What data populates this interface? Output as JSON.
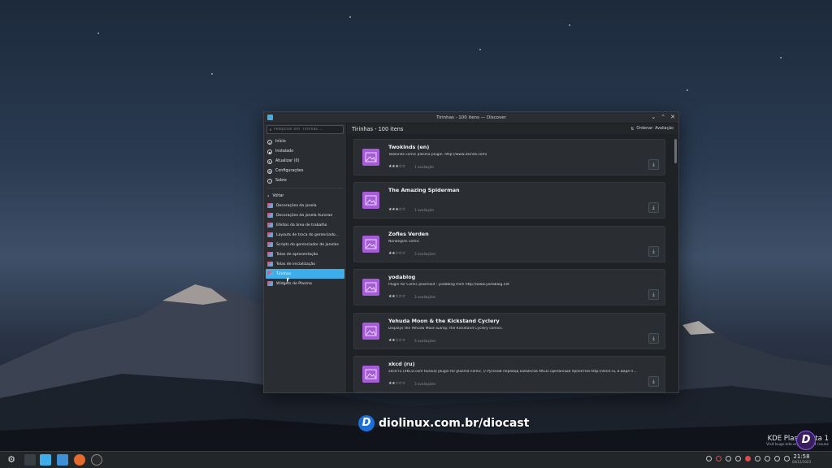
{
  "window": {
    "title": "Tirinhas - 100 itens — Discover",
    "controls": [
      "⌄",
      "⌃",
      "✕"
    ]
  },
  "sidebar": {
    "search_placeholder": "Pesquisar em 'Tirinhas'...",
    "nav": [
      {
        "label": "Início",
        "icon": "home-icon"
      },
      {
        "label": "Instalado",
        "icon": "installed-icon"
      },
      {
        "label": "Atualizar (0)",
        "icon": "update-icon"
      },
      {
        "label": "Configurações",
        "icon": "settings-icon"
      },
      {
        "label": "Sobre",
        "icon": "info-icon"
      }
    ],
    "back_label": "Voltar",
    "categories": [
      "Decorações da janela",
      "Decorações da janela Aurorae",
      "Efeitos da área de trabalho",
      "Layouts de troca do gerenciado...",
      "Scripts do gerenciador de janelas",
      "Telas de apresentação",
      "Telas de inicialização",
      "Tirinhas",
      "Widgets do Plasma"
    ],
    "selected_index": 7
  },
  "main": {
    "title": "Tirinhas - 100 itens",
    "sort_label": "Ordenar: Avaliação",
    "items": [
      {
        "title": "Twokinds (en)",
        "desc": "Twokinds comic plasma plugin. http://www.2kinds.com/",
        "stars": "★★★☆☆",
        "rating": "1 avaliação"
      },
      {
        "title": "The Amazing Spiderman",
        "desc": "",
        "stars": "★★★☆☆",
        "rating": "1 avaliação"
      },
      {
        "title": "Zofies Verden",
        "desc": "Norwegian comic",
        "stars": "★★☆☆☆",
        "rating": "3 avaliações"
      },
      {
        "title": "yodablog",
        "desc": "Plugin for Comic plasmoid : yodablog from http://www.yodablog.net",
        "stars": "★★☆☆☆",
        "rating": "3 avaliações"
      },
      {
        "title": "Yehuda Moon & the Kickstand Cyclery",
        "desc": "Displays the Yehuda Moon &amp; the Kickstand Cyclery comics.",
        "stars": "★★☆☆☆",
        "rating": "3 avaliações"
      },
      {
        "title": "xkcd (ru)",
        "desc": "xkcd-ru (XKCD.com Russia) plugin for plasma-comic. // Русский перевод комиксов XKCD сделанный проектом http://xkcd.ru, в виде п...",
        "stars": "★★☆☆☆",
        "rating": "3 avaliações"
      }
    ]
  },
  "watermark": {
    "logo_letter": "D",
    "text": "diolinux.com.br/diocast"
  },
  "kde": {
    "line1": "KDE Plasma",
    "line1_suffix": "eta 1",
    "line2": "Visit bugs.kde.org to report issues"
  },
  "taskbar": {
    "time": "21:58",
    "date": "04/12/2023"
  }
}
